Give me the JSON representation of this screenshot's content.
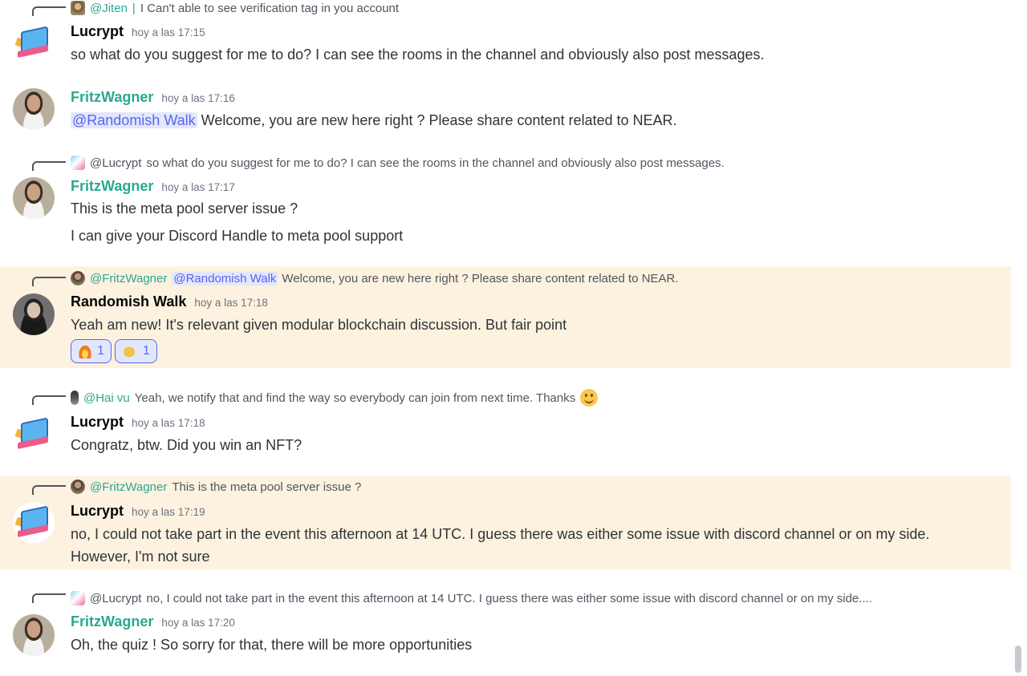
{
  "messages": [
    {
      "reply": {
        "user": "@Jiten",
        "separator": "|",
        "text": "I Can't able to see verification tag in you account"
      },
      "author": "Lucrypt",
      "time": "hoy a las 17:15",
      "lines": [
        "so what do you suggest for me to do?  I can see the rooms in the channel and obviously also post messages."
      ]
    },
    {
      "author": "FritzWagner",
      "time": "hoy a las 17:16",
      "mention": "@Randomish Walk",
      "lines": [
        "Welcome, you are new here right ? Please share content related to NEAR."
      ]
    },
    {
      "reply": {
        "user": "@Lucrypt",
        "text": "so what do you suggest for me to do?  I can see the rooms in the channel and obviously also post messages."
      },
      "author": "FritzWagner",
      "time": "hoy a las 17:17",
      "lines": [
        "This is the meta pool server issue ?",
        "I can give your Discord Handle to meta pool support"
      ]
    },
    {
      "reply": {
        "user": "@FritzWagner",
        "mention": "@Randomish Walk",
        "text": "Welcome, you are new here right ? Please share content related to NEAR."
      },
      "author": "Randomish Walk",
      "time": "hoy a las 17:18",
      "lines": [
        "Yeah am new! It's relevant given modular blockchain discussion. But fair point"
      ],
      "reactions": [
        {
          "emoji": "fire-emoji",
          "count": "1"
        },
        {
          "emoji": "clap-emoji",
          "count": "1"
        }
      ]
    },
    {
      "reply": {
        "user": "@Hai vu",
        "text": "Yeah, we notify that and find the way so everybody can join from next time. Thanks"
      },
      "author": "Lucrypt",
      "time": "hoy a las 17:18",
      "lines": [
        "Congratz, btw. Did you win an NFT?"
      ]
    },
    {
      "reply": {
        "user": "@FritzWagner",
        "text": "This is the meta pool server issue ?"
      },
      "author": "Lucrypt",
      "time": "hoy a las 17:19",
      "lines": [
        "no, I could not take part in the event this afternoon at 14 UTC. I guess there was either some issue with discord channel or on my side. However, I'm not sure"
      ]
    },
    {
      "reply": {
        "user": "@Lucrypt",
        "text": "no, I could not take part in the event this afternoon at 14 UTC. I guess there was either some issue with discord channel or on my side...."
      },
      "author": "FritzWagner",
      "time": "hoy a las 17:20",
      "lines": [
        "Oh, the quiz ! So sorry for that, there will be more opportunities"
      ]
    }
  ],
  "colors": {
    "highlight": "#fcf2df",
    "teal_name": "#2aa890",
    "mention": "#5865f2",
    "mention_bg": "#e3e7fb"
  }
}
